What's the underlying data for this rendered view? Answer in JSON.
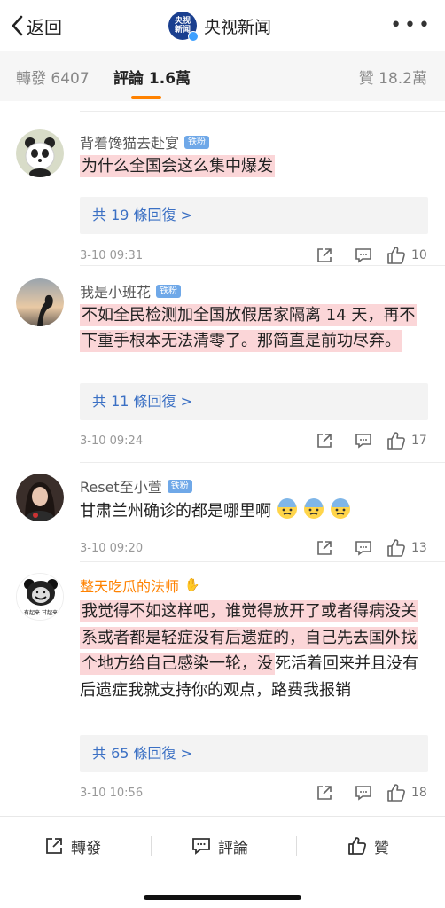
{
  "header": {
    "back_label": "返回",
    "account_name": "央视新闻",
    "logo_text_1": "央视",
    "logo_text_2": "新闻",
    "more_label": "•••"
  },
  "tabs": {
    "forward_label": "轉發 6407",
    "comment_label": "評論 1.6萬",
    "like_label": "贊 18.2萬",
    "active": "comment",
    "accent_color": "#ff8200"
  },
  "comments": [
    {
      "username": "背着馋猫去赴宴",
      "badge": "铁粉",
      "text": "为什么全国会这么集中爆发",
      "highlighted": true,
      "replies_label": "共 19 條回復 >",
      "time": "3-10 09:31",
      "likes": "10",
      "avatar_icon": "panda-avatar"
    },
    {
      "username": "我是小班花",
      "badge": "铁粉",
      "text": "不如全民检测加全国放假居家隔离 14 天，再不下重手根本无法清零了。那简直是前功尽弃。",
      "highlighted": true,
      "replies_label": "共 11 條回復 >",
      "time": "3-10 09:24",
      "likes": "17",
      "avatar_icon": "silhouette-sunset-avatar"
    },
    {
      "username": "Reset至小萱",
      "badge": "铁粉",
      "text": "甘肃兰州确诊的都是哪里啊",
      "highlighted": false,
      "emoji_count": 3,
      "emoji_icon": "cold-sweat-face-emoji",
      "time": "3-10 09:20",
      "likes": "13",
      "avatar_icon": "girl-portrait-avatar"
    },
    {
      "username": "整天吃瓜的法师",
      "badge": "",
      "name_color": "#ff8200",
      "text": "我觉得不如这样吧，谁觉得放开了或者得病没关系或者都是轻症没有后遗症的，自己先去国外找个地方给自己感染一轮，没死活着回来并且没有后遗症我就支持你的观点，路费我报销",
      "highlight_part": "我觉得不如这样吧，谁觉得放开了或者得病没关系或者都是轻症没有后遗症的，自己先去国外找个地方给自己感染一轮，没",
      "plain_part": "死活着回来并且没有后遗症我就支持你的观点，路费我报销",
      "replies_label": "共 65 條回復 >",
      "time": "3-10 10:56",
      "likes": "18",
      "avatar_icon": "meme-bear-avatar",
      "avatar_caption": "有起来 甘起来"
    }
  ],
  "bottom_bar": {
    "forward_label": "轉發",
    "comment_label": "評論",
    "like_label": "贊"
  }
}
